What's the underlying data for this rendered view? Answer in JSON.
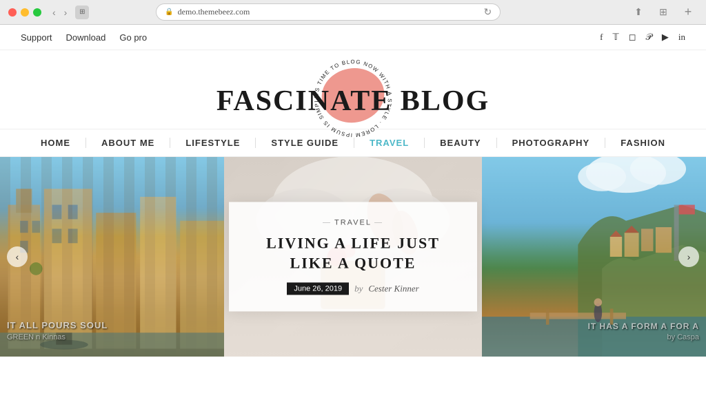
{
  "browser": {
    "url": "demo.themebeez.com",
    "tab_icon": "🌐"
  },
  "top_bar": {
    "nav_links": [
      "Support",
      "Download",
      "Go pro"
    ],
    "social_links": [
      {
        "icon": "f",
        "name": "facebook"
      },
      {
        "icon": "t",
        "name": "twitter"
      },
      {
        "icon": "◻",
        "name": "instagram"
      },
      {
        "icon": "p",
        "name": "pinterest"
      },
      {
        "icon": "▶",
        "name": "youtube"
      },
      {
        "icon": "in",
        "name": "linkedin"
      }
    ]
  },
  "logo": {
    "title": "FASCINATE BLOG",
    "circular_text": "ITS TIME TO BLOG NOW WITH A STYLE · LOREM IPSUM IS SIMPLY A DUMMY ·"
  },
  "nav": {
    "items": [
      {
        "label": "HOME",
        "active": false
      },
      {
        "label": "ABOUT ME",
        "active": false
      },
      {
        "label": "LIFESTYLE",
        "active": false
      },
      {
        "label": "STYLE GUIDE",
        "active": false
      },
      {
        "label": "TRAVEL",
        "active": true
      },
      {
        "label": "BEAUTY",
        "active": false
      },
      {
        "label": "PHOTOGRAPHY",
        "active": false
      },
      {
        "label": "FASHION",
        "active": false
      }
    ]
  },
  "hero": {
    "slides": [
      {
        "id": "slide-1",
        "label": "Venice canal slide",
        "overlay_line1": "IT ALL POURS SOUL",
        "overlay_line2": "GREEN n Kinnas"
      },
      {
        "id": "slide-2",
        "label": "Bed books slide"
      },
      {
        "id": "slide-3",
        "label": "Cinque Terre slide",
        "overlay_line1": "IT HAS A FORM A FOR A",
        "overlay_line2": "by Caspa"
      }
    ],
    "center_card": {
      "category": "TRAVEL",
      "title": "LIVING A LIFE JUST LIKE A QUOTE",
      "date": "June 26, 2019",
      "by_label": "by",
      "author": "Cester Kinner"
    },
    "arrow_left": "‹",
    "arrow_right": "›"
  }
}
